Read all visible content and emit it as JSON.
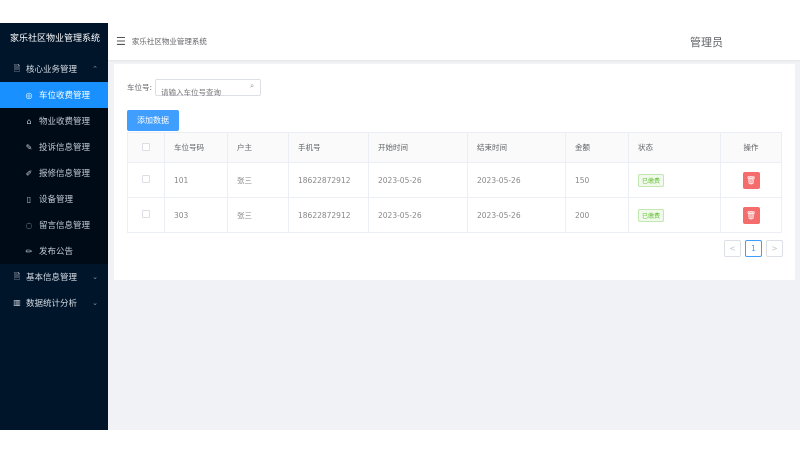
{
  "sidebar": {
    "brand": "家乐社区物业管理系统",
    "groups": [
      {
        "label": "核心业务管理",
        "icon": "document-icon",
        "chev": "^"
      },
      {
        "label": "基本信息管理",
        "icon": "document-icon",
        "chev": "v"
      },
      {
        "label": "数据统计分析",
        "icon": "chart-icon",
        "chev": "v"
      }
    ],
    "items": [
      {
        "label": "车位收费管理",
        "icon": "car-icon"
      },
      {
        "label": "物业收费管理",
        "icon": "home-icon"
      },
      {
        "label": "投诉信息管理",
        "icon": "edit-icon"
      },
      {
        "label": "报修信息管理",
        "icon": "edit-icon"
      },
      {
        "label": "设备管理",
        "icon": "device-icon"
      },
      {
        "label": "留言信息管理",
        "icon": "message-icon"
      },
      {
        "label": "发布公告",
        "icon": "pen-icon"
      }
    ]
  },
  "header": {
    "breadcrumb": "家乐社区物业管理系统",
    "user": "管理员"
  },
  "search": {
    "label": "车位号:",
    "placeholder": "请输入车位号查询"
  },
  "toolbar": {
    "add_label": "添加数据"
  },
  "table": {
    "headers": [
      "车位号码",
      "户主",
      "手机号",
      "开始时间",
      "结束时间",
      "金额",
      "状态",
      "操作"
    ],
    "rows": [
      {
        "space": "101",
        "owner": "张三",
        "phone": "18622872912",
        "start": "2023-05-26",
        "end": "2023-05-26",
        "amount": "150",
        "status": "已缴费"
      },
      {
        "space": "303",
        "owner": "张三",
        "phone": "18622872912",
        "start": "2023-05-26",
        "end": "2023-05-26",
        "amount": "200",
        "status": "已缴费"
      }
    ]
  },
  "pager": {
    "prev": "<",
    "current": "1",
    "next": ">"
  },
  "colors": {
    "sidebar_bg": "#00152a",
    "accent": "#1890ff",
    "button": "#409eff",
    "danger": "#f56c6c",
    "success": "#67c23a"
  }
}
